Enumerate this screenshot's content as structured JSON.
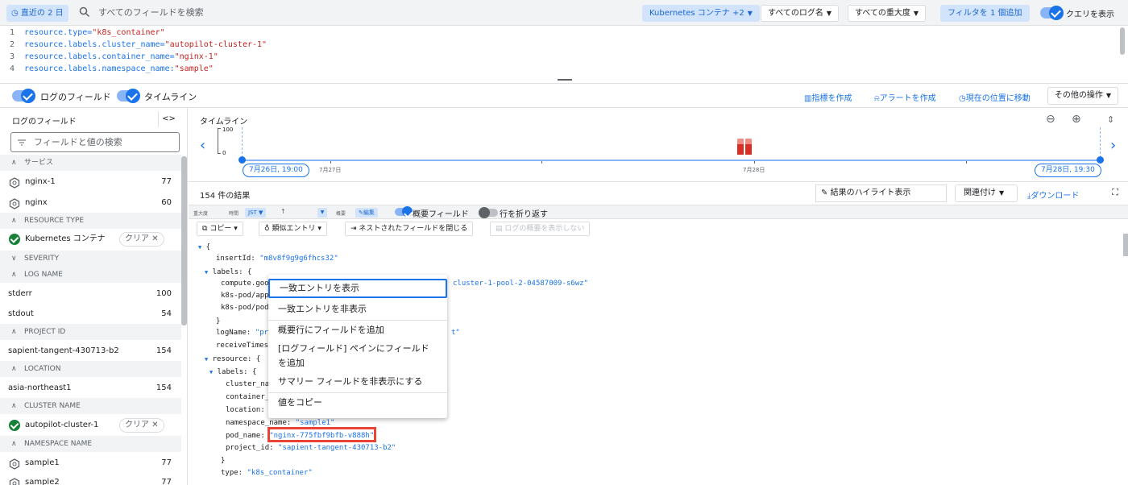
{
  "topbar": {
    "recent_chip": "直近の 2 日",
    "search_placeholder": "すべてのフィールドを検索",
    "resource_btn": "Kubernetes コンテナ +2",
    "lognames_btn": "すべてのログ名",
    "severity_btn": "すべての重大度",
    "add_filter_btn": "フィルタを 1 個追加",
    "show_query_label": "クエリを表示"
  },
  "query": {
    "lines": [
      {
        "num": "1",
        "key": "resource.type=",
        "val": "\"k8s_container\""
      },
      {
        "num": "2",
        "key": "resource.labels.cluster_name=",
        "val": "\"autopilot-cluster-1\""
      },
      {
        "num": "3",
        "key": "resource.labels.container_name=",
        "val": "\"nginx-1\""
      },
      {
        "num": "4",
        "key": "resource.labels.namespace_name:",
        "val": "\"sample\""
      }
    ]
  },
  "toolbar": {
    "log_fields_label": "ログのフィールド",
    "timeline_label": "タイムライン",
    "create_metric": "指標を作成",
    "create_alert": "アラートを作成",
    "jump_now": "現在の位置に移動",
    "more_actions": "その他の操作"
  },
  "leftpanel": {
    "title": "ログのフィールド",
    "collapse": "<>",
    "search_placeholder": "フィールドと値の検索",
    "clear_label": "クリア",
    "sections": {
      "service": "サービス",
      "resource_type": "RESOURCE TYPE",
      "severity": "SEVERITY",
      "log_name": "LOG NAME",
      "project_id": "PROJECT ID",
      "location": "LOCATION",
      "cluster_name": "CLUSTER NAME",
      "namespace_name": "NAMESPACE NAME"
    },
    "rows": {
      "nginx1": {
        "label": "nginx-1",
        "count": "77"
      },
      "nginx": {
        "label": "nginx",
        "count": "60"
      },
      "k8s": {
        "label": "Kubernetes コンテナ"
      },
      "stderr": {
        "label": "stderr",
        "count": "100"
      },
      "stdout": {
        "label": "stdout",
        "count": "54"
      },
      "project": {
        "label": "sapient-tangent-430713-b2",
        "count": "154"
      },
      "location": {
        "label": "asia-northeast1",
        "count": "154"
      },
      "cluster": {
        "label": "autopilot-cluster-1"
      },
      "sample1": {
        "label": "sample1",
        "count": "77"
      },
      "sample2": {
        "label": "sample2",
        "count": "77"
      }
    }
  },
  "timeline": {
    "title": "タイムライン",
    "y_top": "100",
    "y_bottom": "0",
    "start_chip": "7月26日, 19:00",
    "end_chip": "7月28日, 19:30",
    "date_27": "7月27日",
    "date_28": "7月28日"
  },
  "results": {
    "count": "154 件の結果",
    "highlight": "結果のハイライト表示",
    "correlate": "関連付け",
    "download": "ダウンロード"
  },
  "colhead": {
    "severity": "重大度",
    "time": "時間",
    "jst": "JST",
    "summary": "概要",
    "edit": "編集",
    "summary_fields": "概要フィールド",
    "wrap_lines": "行を折り返す"
  },
  "entrybar": {
    "copy": "コピー",
    "similar": "類似エントリ",
    "collapse_nested": "ネストされたフィールドを閉じる",
    "hide_summary": "ログの概要を表示しない"
  },
  "json": {
    "open_brace": "{",
    "insertId_key": "insertId:",
    "insertId_val": "\"m8v8f9g9g6fhcs32\"",
    "labels_key": "labels: {",
    "compute_key": "compute.goo",
    "compute_val": "cluster-1-pool-2-04587009-s6wz\"",
    "app_key": "k8s-pod/app",
    "pod_key": "k8s-pod/pod",
    "close_brace": "}",
    "logname_key": "logName:",
    "logname_val": "\"pro",
    "logname_tail": "t\"",
    "receive_key": "receiveTimest",
    "resource_key": "resource: {",
    "res_labels_key": "labels: {",
    "cluster_key": "cluster_na",
    "container_key": "container_",
    "location_key": "location:",
    "namespace_key": "namespace_name:",
    "namespace_val": "\"sample1\"",
    "podname_key": "pod_name:",
    "podname_val": "\"nginx-775fbf9bfb-v888h\"",
    "project_key": "project_id:",
    "project_val": "\"sapient-tangent-430713-b2\"",
    "type_key": "type:",
    "type_val": "\"k8s_container\""
  },
  "context_menu": {
    "items": [
      "一致エントリを表示",
      "一致エントリを非表示",
      "概要行にフィールドを追加",
      "[ログフィールド] ペインにフィールド",
      "を追加",
      "サマリー フィールドを非表示にする",
      "値をコピー"
    ]
  }
}
